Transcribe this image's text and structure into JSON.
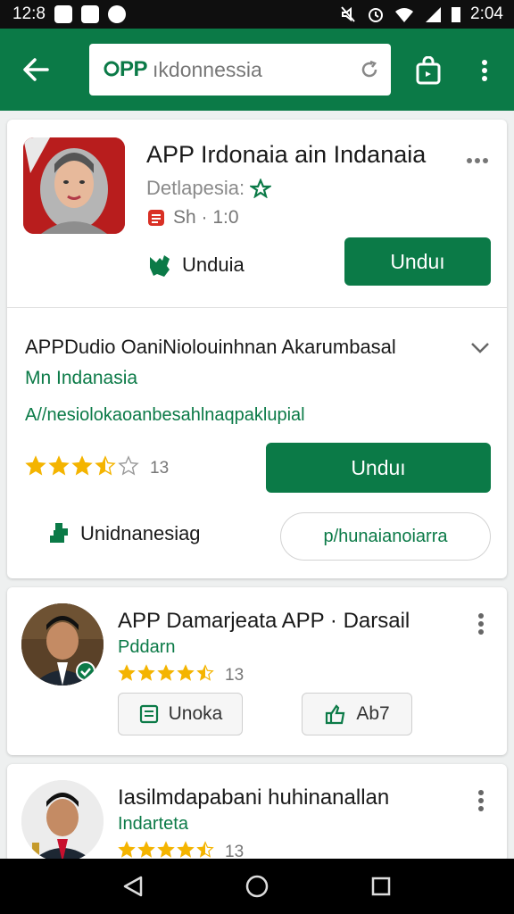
{
  "status_bar": {
    "left_time": "12:8",
    "left_icons": [
      "notification-icon",
      "mail-icon",
      "image-icon",
      "app-icon"
    ],
    "right_icons": [
      "mute-icon",
      "alarm-icon",
      "wifi-icon",
      "signal-icon",
      "battery-icon"
    ],
    "clock": "2:04"
  },
  "app_bar": {
    "brand": "PP",
    "query": "ıkdonnessia",
    "accent": "#0b7a47"
  },
  "featured": {
    "title": "APP Irdonaia ain Indanaia",
    "developer": "Detlapesia:",
    "meta": "Sh · 1:0",
    "tag_label": "Unduia",
    "install_label": "Unduı",
    "desc_title": "APPDudio OaniNiolouinhnan Akarumbasal",
    "desc_sub": "Mn Indanasia",
    "desc_line": "A//nesiolokaoanbesahlnaqpaklupial",
    "rating": 3.5,
    "rating_count": "13",
    "install2_label": "Unduı",
    "dev2_label": "Unidnanesiag",
    "secondary_label": "p/hunaianoiarra"
  },
  "list": [
    {
      "title": "APP Damarjeata APP · Darsail",
      "subtitle": "Pddarn",
      "rating": 4.5,
      "rating_count": "13",
      "chip1_label": "Unoka",
      "chip2_label": "Ab7"
    },
    {
      "title": "Iasilmdapabani huhinanallan",
      "subtitle": "Indarteta",
      "rating": 4.5,
      "rating_count": "13"
    }
  ]
}
